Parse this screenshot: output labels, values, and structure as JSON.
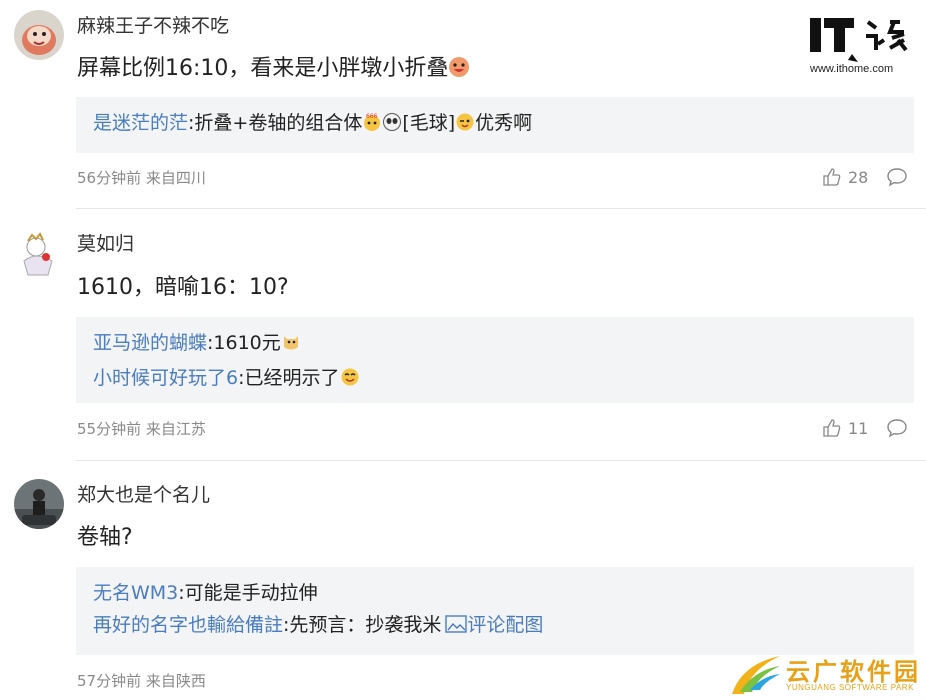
{
  "watermark": {
    "url": "www.ithome.com",
    "logo_text": "IT之家"
  },
  "corner_watermark": {
    "name": "云广软件园",
    "subtitle": "YUNGUANG SOFTWARE PARK"
  },
  "comments": [
    {
      "username": "麻辣王子不辣不吃",
      "content": "屏幕比例16:10，看来是小胖墩小折叠",
      "quotes": [
        {
          "name": "是迷茫的茫",
          "text": ":折叠+卷轴的组合体",
          "suffix": "[毛球]",
          "tail": "优秀啊"
        }
      ],
      "meta": "56分钟前 来自四川",
      "likes": "28"
    },
    {
      "username": "莫如归",
      "content": "1610，暗喻16：10?",
      "quotes": [
        {
          "name": "亚马逊的蝴蝶",
          "text": ":1610元"
        },
        {
          "name": "小时候可好玩了6",
          "text": ":已经明示了"
        }
      ],
      "meta": "55分钟前 来自江苏",
      "likes": "11"
    },
    {
      "username": "郑大也是个名儿",
      "content": "卷轴?",
      "quotes": [
        {
          "name": "无名WM3",
          "text": ":可能是手动拉伸"
        },
        {
          "name": "再好的名字也輸給備註",
          "text": ":先预言：抄袭我米",
          "link": "评论配图"
        }
      ],
      "meta": "57分钟前 来自陕西"
    }
  ],
  "colors": {
    "name_blue": "#4a7cc0",
    "quote_bg": "#f3f4f6",
    "meta_gray": "#8a8a8a"
  }
}
